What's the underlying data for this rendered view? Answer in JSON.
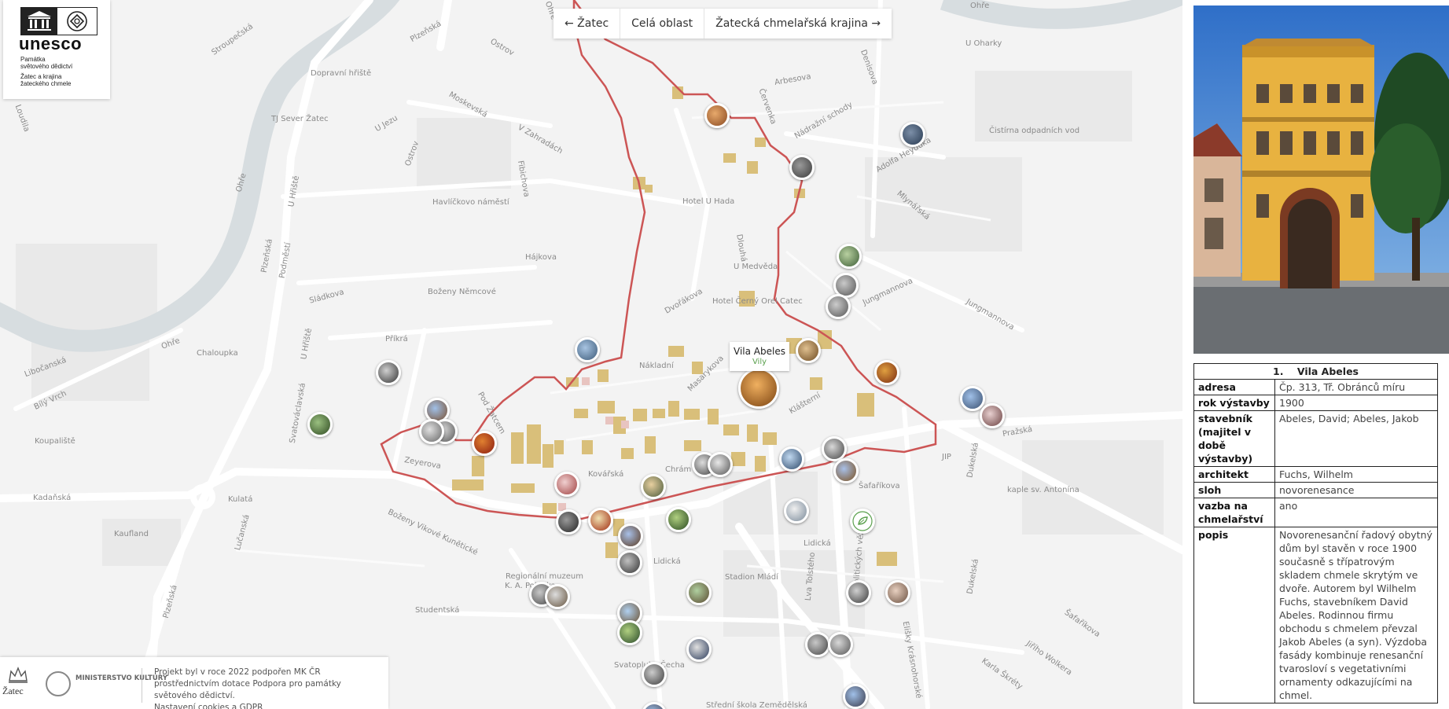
{
  "logo": {
    "wordmark": "unesco",
    "line1": "Památka",
    "line2": "světového dědictví",
    "line3": "Žatec a krajina",
    "line4": "žateckého chmele"
  },
  "nav": {
    "prev_label": "← Žatec",
    "all_label": "Celá oblast",
    "next_label": "Žatecká chmelařská krajina →"
  },
  "tooltip": {
    "title": "Vila Abeles",
    "category": "Vily"
  },
  "map_labels": [
    {
      "text": "Stroupečská"
    },
    {
      "text": "Plzeňská"
    },
    {
      "text": "Ostrov"
    },
    {
      "text": "Dopravní hřiště"
    },
    {
      "text": "Moskevská"
    },
    {
      "text": "U Jezu"
    },
    {
      "text": "V Zahradách"
    },
    {
      "text": "TJ Sever Žatec"
    },
    {
      "text": "Ostrov"
    },
    {
      "text": "Fibichova"
    },
    {
      "text": "Ohře"
    },
    {
      "text": "Havlíčkovo náměstí"
    },
    {
      "text": "Hájkova"
    },
    {
      "text": "Boženy Němcové"
    },
    {
      "text": "Sládkova"
    },
    {
      "text": "Příkrá"
    },
    {
      "text": "Ohře"
    },
    {
      "text": "Chaloupka"
    },
    {
      "text": "Libočanská"
    },
    {
      "text": "Bílý Vrch"
    },
    {
      "text": "Koupaliště"
    },
    {
      "text": "Kadaňská"
    },
    {
      "text": "Kulatá"
    },
    {
      "text": "Kaufland"
    },
    {
      "text": "Lučanská"
    },
    {
      "text": "Plzeňská"
    },
    {
      "text": "Studentská"
    },
    {
      "text": "Zeyerova"
    },
    {
      "text": "Kovářská"
    },
    {
      "text": "Boženy Vikové Kunětické"
    },
    {
      "text": "Regionální muzeum"
    },
    {
      "text": "K. A. Polánka"
    },
    {
      "text": "Lidická"
    },
    {
      "text": "Stadion Mládí"
    },
    {
      "text": "Lidická"
    },
    {
      "text": "Arbesova"
    },
    {
      "text": "Nádražní schody"
    },
    {
      "text": "Adolfa Heyduka"
    },
    {
      "text": "Čistírna odpadních vod"
    },
    {
      "text": "Mlynářská"
    },
    {
      "text": "U Oharky"
    },
    {
      "text": "Hotel U Hada"
    },
    {
      "text": "U Medvěda"
    },
    {
      "text": "Hotel Černý Orel Catec"
    },
    {
      "text": "Dvořákova"
    },
    {
      "text": "Nákladní"
    },
    {
      "text": "Masarykova"
    },
    {
      "text": "Klášterní"
    },
    {
      "text": "Chrám"
    },
    {
      "text": "Jungmannova"
    },
    {
      "text": "Jungmannova"
    },
    {
      "text": "Pražská"
    },
    {
      "text": "JIP"
    },
    {
      "text": "Šafaříkova"
    },
    {
      "text": "kaple sv. Antonína"
    },
    {
      "text": "Dukelská"
    },
    {
      "text": "Dukelská"
    },
    {
      "text": "Šafaříkova"
    },
    {
      "text": "Jiřího Wolkera"
    },
    {
      "text": "Karla Škréty"
    },
    {
      "text": "Elišky Krásnohorské"
    },
    {
      "text": "Svatopluka Čecha"
    },
    {
      "text": "Střední škola Zemědělská"
    },
    {
      "text": "Lva Tolstého"
    },
    {
      "text": "Politických vězňů"
    },
    {
      "text": "U Hřiště"
    },
    {
      "text": "Podměstí"
    },
    {
      "text": "Plzeňská"
    },
    {
      "text": "Svatováclavská"
    },
    {
      "text": "Pod Žatcem"
    },
    {
      "text": "Ohře"
    },
    {
      "text": "Dlouhá"
    },
    {
      "text": "Červenka"
    },
    {
      "text": "Denisova"
    },
    {
      "text": "Loudila"
    },
    {
      "text": "U Hřiště"
    },
    {
      "text": "Ohře"
    }
  ],
  "footer": {
    "town": "Žatec",
    "ministry": "MINISTERSTVO KULTURY",
    "text": "Projekt byl v roce 2022 podpořen MK ČR prostřednictvím dotace Podpora pro památky světového dědictví.",
    "cookies": "Nastavení cookies",
    "and": " a ",
    "gdpr": "GDPR"
  },
  "detail": {
    "number": "1.",
    "title": "Vila Abeles",
    "rows": [
      {
        "key": "adresa",
        "value": "Čp. 313, Tř. Obránců míru"
      },
      {
        "key": "rok výstavby",
        "value": "1900"
      },
      {
        "key": "stavebník (majitel v době výstavby)",
        "value": "Abeles, David; Abeles, Jakob"
      },
      {
        "key": "architekt",
        "value": "Fuchs, Wilhelm"
      },
      {
        "key": "sloh",
        "value": "novorenesance"
      },
      {
        "key": "vazba na chmelařství",
        "value": "ano"
      },
      {
        "key": "popis",
        "value": "Novorenesanční řadový obytný dům byl stavěn v roce 1900 současně s třípatrovým skladem chmele skrytým ve dvoře. Autorem byl Wilhelm Fuchs, stavebníkem David Abeles. Rodinnou firmu obchodu s chmelem převzal Jakob Abeles (a syn). Výzdoba fasády kombinuje renesanční tvarosloví s vegetativními ornamenty odkazujícími na chmel."
      }
    ]
  },
  "colors": {
    "boundary": "#cc5555",
    "river": "#d7dde0",
    "building": "#d9bf7a",
    "accent_green": "#5aa04d"
  }
}
